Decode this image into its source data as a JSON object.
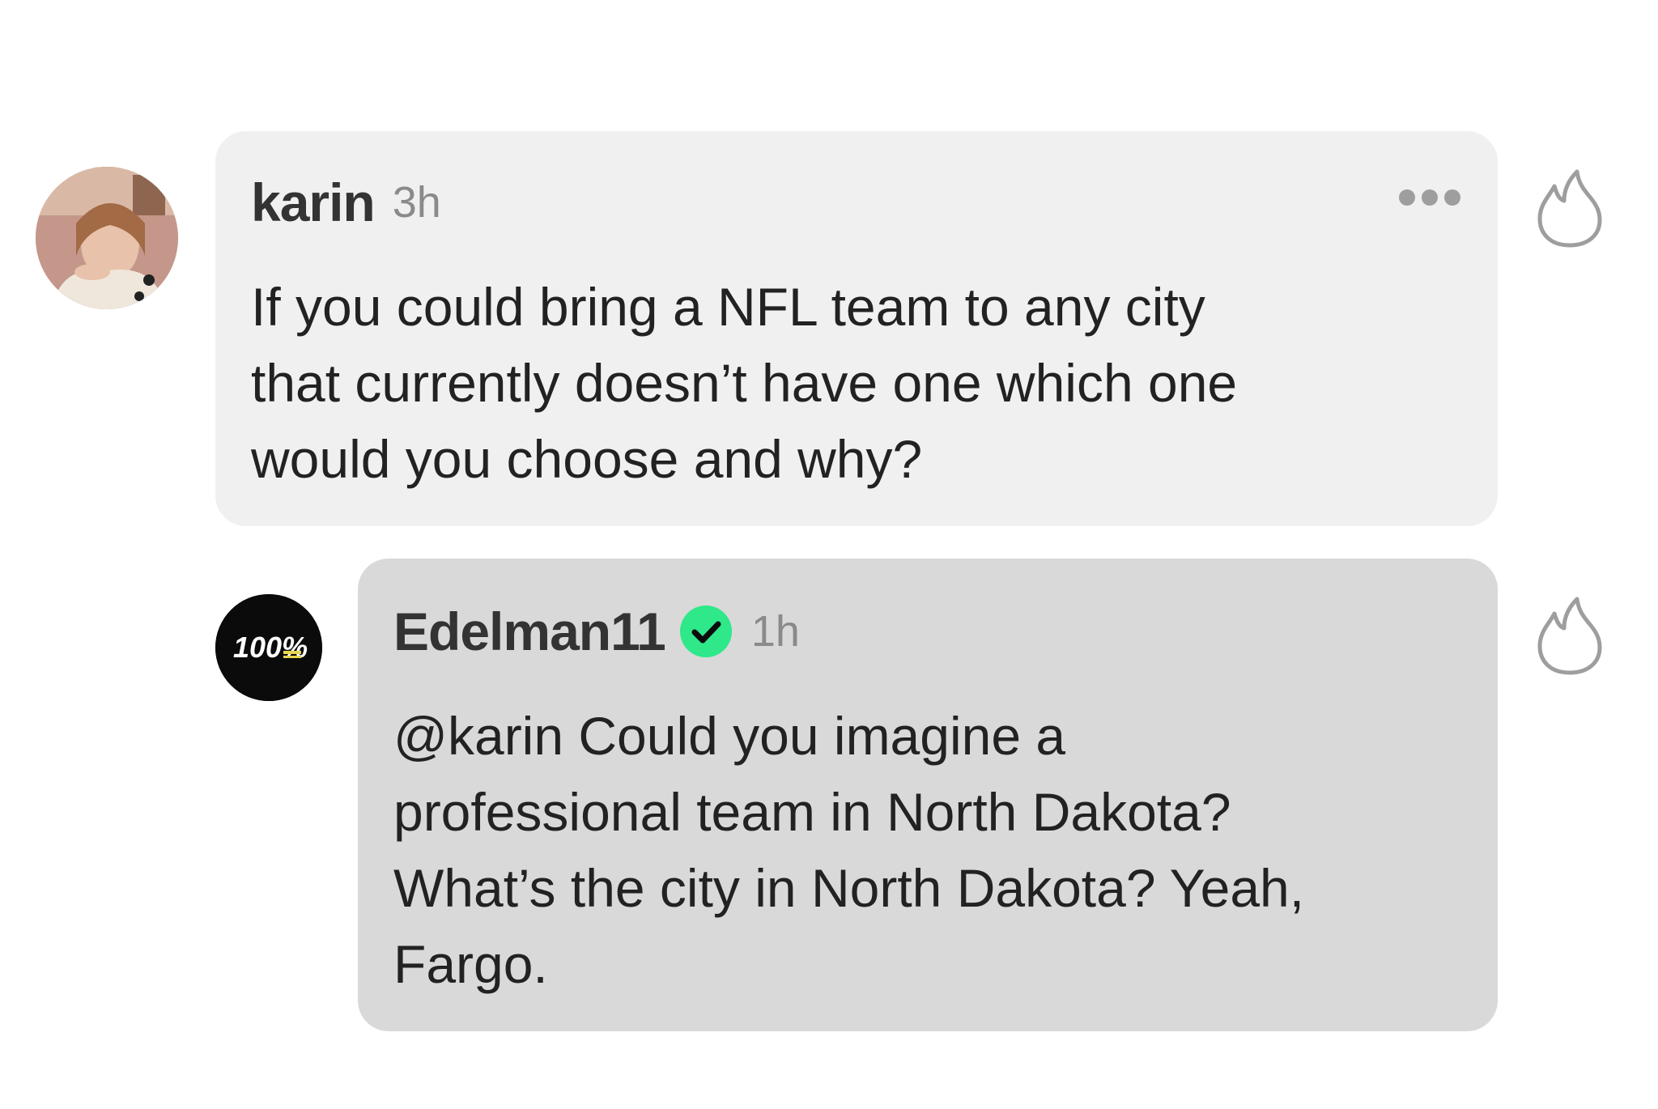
{
  "comments": [
    {
      "username": "karin",
      "time": "3h",
      "text": "If you could bring a NFL team to any city\nthat currently doesn’t have one which one\nwould you choose and why?"
    },
    {
      "username": "Edelman11",
      "time": "1h",
      "verified": true,
      "avatar_text": "100%",
      "text": "@karin Could you imagine a\nprofessional team in North Dakota?\nWhat’s the city in North Dakota? Yeah,\nFargo."
    }
  ],
  "colors": {
    "question_bubble": "#f0f0f0",
    "reply_bubble": "#d9d9d9",
    "verified_badge": "#2ee88a",
    "icon_stroke": "#9e9e9e"
  },
  "icons": [
    "more-options-icon",
    "fire-icon",
    "verified-check-icon"
  ]
}
